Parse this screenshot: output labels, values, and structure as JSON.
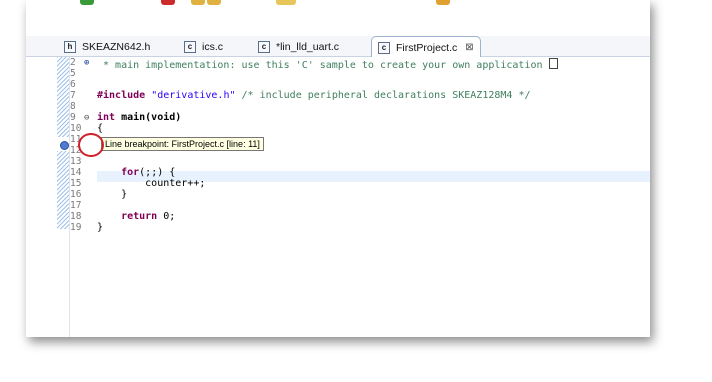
{
  "tabs": [
    {
      "icon": "h",
      "label": "SKEAZN642.h"
    },
    {
      "icon": "c",
      "label": "ics.c"
    },
    {
      "icon": "c",
      "label": "*lin_lld_uart.c"
    },
    {
      "icon": "c",
      "label": "FirstProject.c",
      "close": "⊠"
    }
  ],
  "line_numbers": [
    "2",
    "5",
    "6",
    "7",
    "8",
    "9",
    "10",
    "11",
    "12",
    "13",
    "14",
    "15",
    "16",
    "17",
    "18",
    "19"
  ],
  "fold_markers": {
    "expand": "⊕",
    "collapse": "⊖"
  },
  "code": {
    "l2_comment": " * main implementation: use this 'C' sample to create your own application",
    "l7_directive": "#include",
    "l7_string": " \"derivative.h\"",
    "l7_comment": " /* include peripheral declarations SKEAZ128M4 */",
    "l9_kw": "int",
    "l9_rest": " main(void)",
    "l10": "{",
    "l13_kw": "    for",
    "l13_rest": "(;;) {",
    "l14": "        counter++;",
    "l15": "    }",
    "l17_kw": "    return",
    "l17_rest": " 0;",
    "l18": "}"
  },
  "tooltip": "Line breakpoint: FirstProject.c [line: 11]",
  "colors": {
    "keyword": "#7f0055",
    "string": "#2a00ff",
    "comment": "#3f7f5f",
    "annotation_circle": "#d0202a"
  }
}
